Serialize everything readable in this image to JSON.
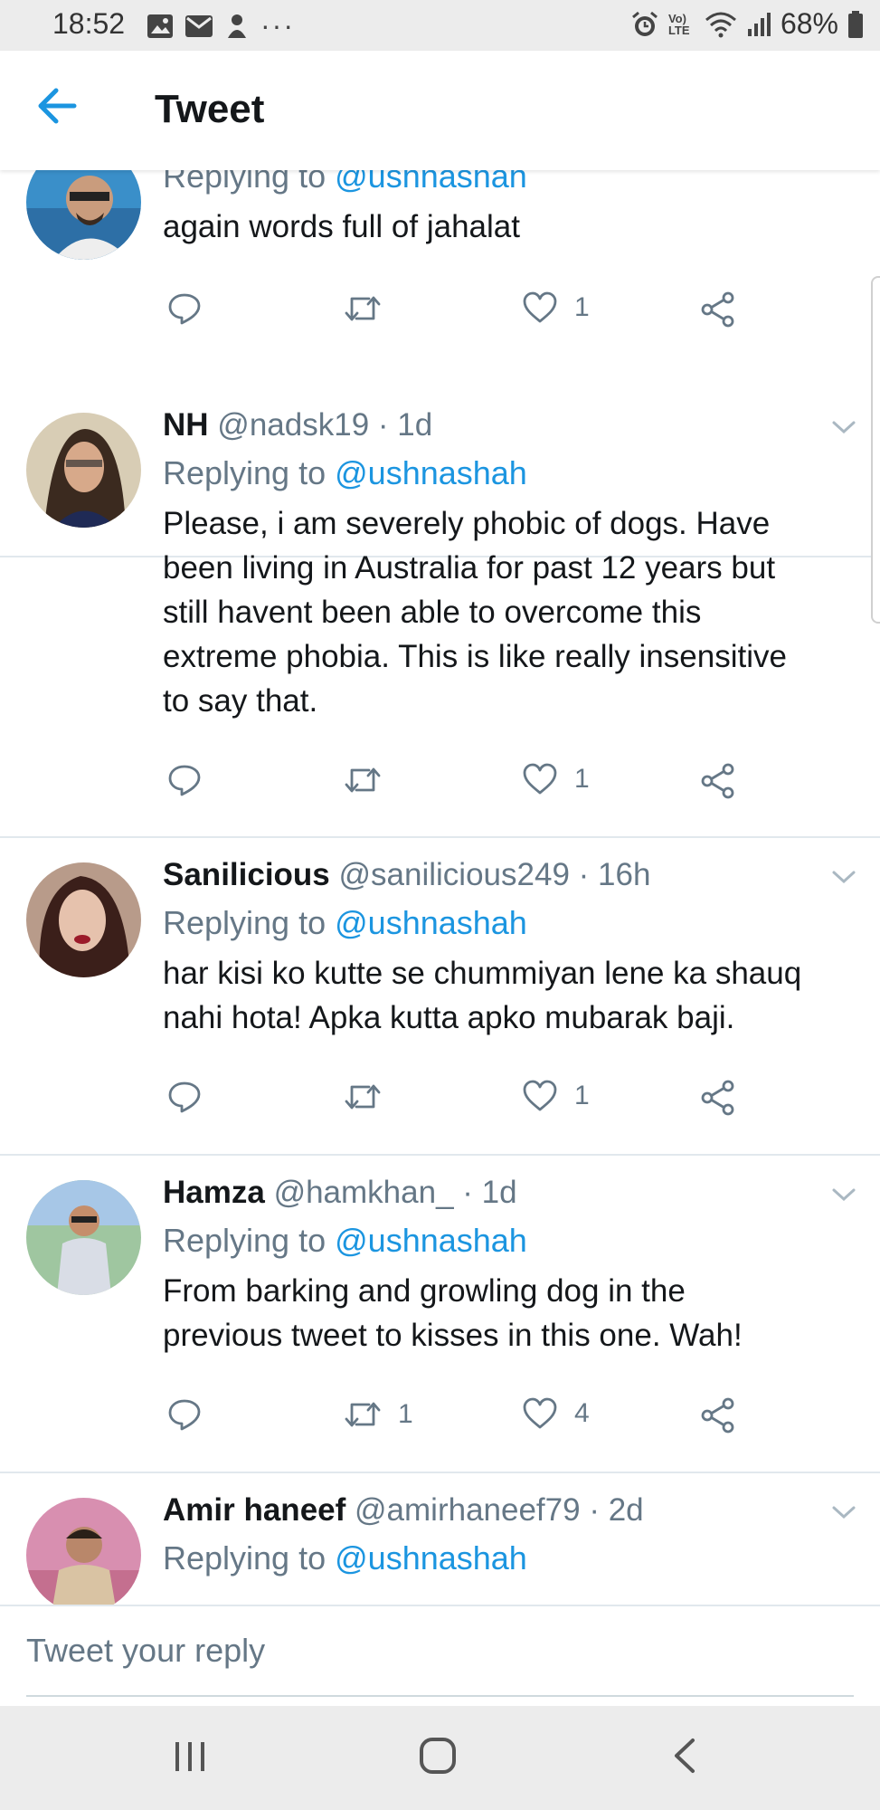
{
  "status_bar": {
    "time": "18:52",
    "network": "Vo) LTE",
    "battery": "68%"
  },
  "header": {
    "title": "Tweet",
    "back_icon": "arrow-left-icon"
  },
  "accent_color": "#1b95e0",
  "tweets": [
    {
      "name": "",
      "handle": "",
      "time": "",
      "replying_label": "Replying to",
      "replying_to": "@ushnashah",
      "text": "again words full of jahalat",
      "retweets": "",
      "likes": "1"
    },
    {
      "name": "NH",
      "handle": "@nadsk19",
      "time": "1d",
      "replying_label": "Replying to",
      "replying_to": "@ushnashah",
      "text": "Please, i am severely phobic of dogs. Have\nbeen living in Australia for past 12 years but\nstill havent been able to overcome this\nextreme phobia. This is like really insensitive\nto say that.",
      "retweets": "",
      "likes": "1"
    },
    {
      "name": "Sanilicious",
      "handle": "@sanilicious249",
      "time": "16h",
      "replying_label": "Replying to",
      "replying_to": "@ushnashah",
      "text": "har kisi ko kutte se chummiyan lene ka shauq\nnahi hota! Apka kutta apko mubarak baji.",
      "retweets": "",
      "likes": "1"
    },
    {
      "name": "Hamza",
      "handle": "@hamkhan_",
      "time": "1d",
      "replying_label": "Replying to",
      "replying_to": "@ushnashah",
      "text": "From barking and growling dog in the\nprevious tweet to kisses in this one. Wah!",
      "retweets": "1",
      "likes": "4"
    },
    {
      "name": "Amir haneef",
      "handle": "@amirhaneef79",
      "time": "2d",
      "replying_label": "Replying to",
      "replying_to": "@ushnashah",
      "text": "",
      "retweets": "",
      "likes": ""
    }
  ],
  "reply_box": {
    "placeholder": "Tweet your reply"
  },
  "nav_bar": {
    "icons": [
      "recent-apps-icon",
      "home-icon",
      "back-icon"
    ]
  }
}
